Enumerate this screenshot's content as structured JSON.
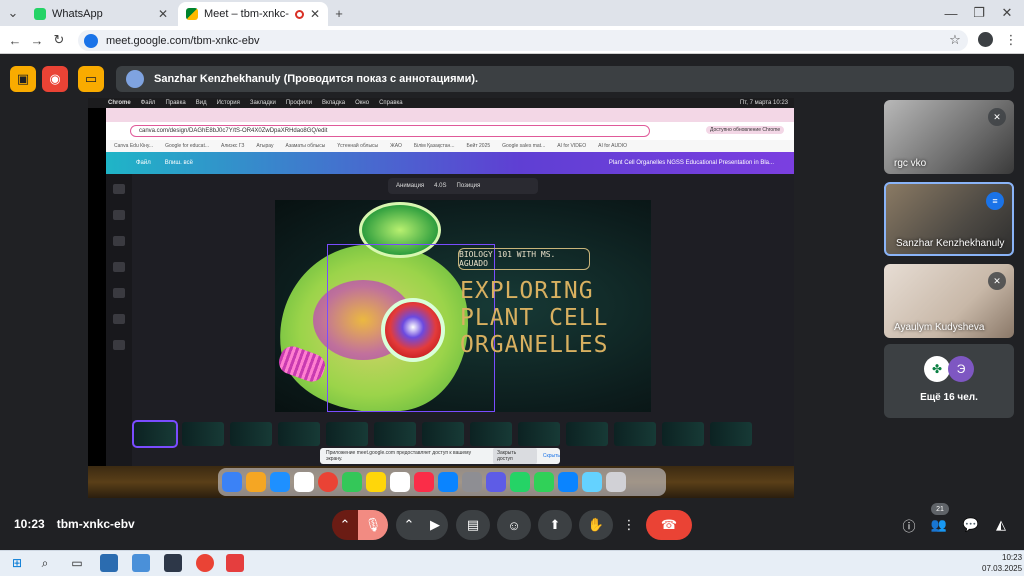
{
  "browser": {
    "tabs": [
      {
        "title": "WhatsApp",
        "active": false
      },
      {
        "title": "Meet – tbm-xnkc-ebv",
        "active": true
      }
    ],
    "new_tab_label": "+",
    "url": "meet.google.com/tbm-xnkc-ebv"
  },
  "meet": {
    "presenter_banner": "Sanzhar Kenzhekhanuly (Проводится показ с аннотациями).",
    "meeting_time": "10:23",
    "meeting_code": "tbm-xnkc-ebv",
    "participants": [
      {
        "name": "rgc vko",
        "muted": true
      },
      {
        "name": "Sanzhar Kenzhekhanuly",
        "muted": false,
        "speaking": true
      },
      {
        "name": "Ayaulym Kudysheva",
        "muted": true
      }
    ],
    "more_participants": {
      "avatar_letter": "Э",
      "label": "Ещё 16 чел."
    },
    "people_count": "21",
    "colors": {
      "end_call": "#ea4335",
      "banner": "#3c4043",
      "accent": "#8ab4f8"
    }
  },
  "shared": {
    "mac_menu": [
      "Chrome",
      "Файл",
      "Правка",
      "Вид",
      "История",
      "Закладки",
      "Профили",
      "Вкладка",
      "Окно",
      "Справка"
    ],
    "mac_clock": "Пт, 7 марта 10:23",
    "inner_url": "canva.com/design/DAGhE8bJ0c7Y/tS-OR4X0ZwDpaXRHdao8GQ/edit",
    "update_label": "Доступно обновление Chrome",
    "bookmarks": [
      "Canva Edu Кіну...",
      "Google for educat...",
      "Алиэкс ГЗ",
      "Атырау",
      "Азаматы облысы",
      "Үстеннай облысы",
      "ЖАО",
      "Білім Қазақстан...",
      "Бейт 2025",
      "Google sales mat...",
      "AI for VIDEO",
      "AI for AUDIO"
    ],
    "canva_file": "Файл",
    "canva_edit": "Впиш. всё",
    "canva_doc_title": "Plant Cell Organelles NGSS Educational Presentation in Bla...",
    "toolbar": {
      "animation": "Анимация",
      "duration": "4.0S",
      "position": "Позиция"
    },
    "slide": {
      "pill": "BIOLOGY 101 WITH MS. AGUADO",
      "title_lines": [
        "EXPLORING",
        "PLANT CELL",
        "ORGANELLES"
      ]
    },
    "share_notice": {
      "text": "Приложение meet.google.com предоставляет доступ к вашему экрану.",
      "stop": "Закрыть доступ",
      "hide": "Скрыть"
    }
  },
  "taskbar": {
    "time": "10:23",
    "date": "07.03.2025"
  }
}
